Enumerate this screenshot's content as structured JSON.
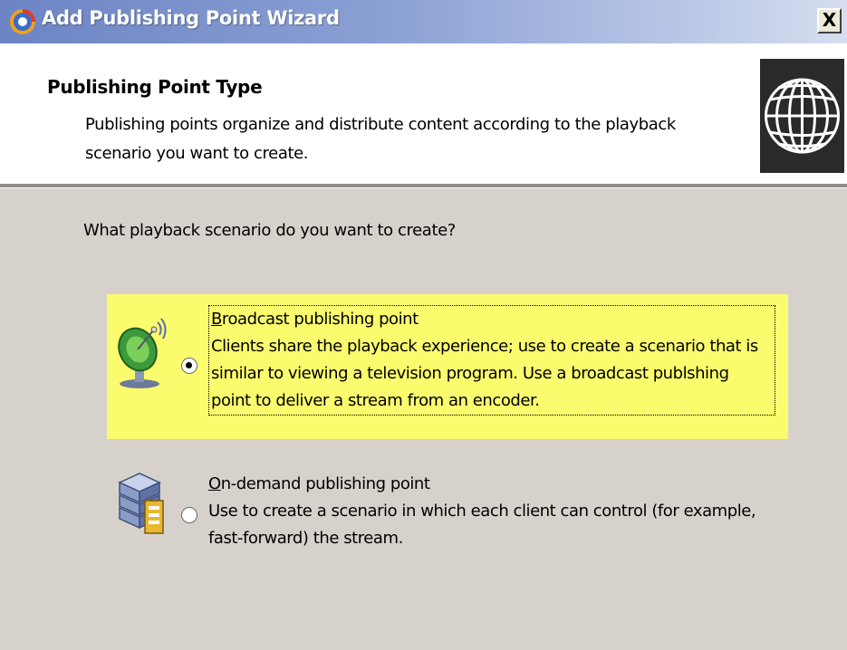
{
  "window": {
    "title": "Add Publishing Point Wizard",
    "close_label": "X"
  },
  "header": {
    "title": "Publishing Point Type",
    "description": "Publishing points organize and distribute content according to the playback scenario you want to create.",
    "logo_icon": "globe-icon"
  },
  "body": {
    "question": "What playback scenario do you want to create?",
    "options": [
      {
        "mnemonic": "B",
        "title_rest": "roadcast publishing point",
        "description": "Clients share the playback experience; use to create a scenario that is similar to viewing a television program. Use a broadcast publshing point to deliver a stream from an encoder.",
        "selected": true,
        "icon": "satellite-dish-icon"
      },
      {
        "mnemonic": "O",
        "title_rest": "n-demand publishing point",
        "description": "Use to create a scenario in which each client can control (for example, fast-forward) the stream.",
        "selected": false,
        "icon": "server-storage-icon"
      }
    ]
  },
  "colors": {
    "highlight": "#fbfb6e",
    "dialog_background": "#d6d2cb",
    "titlebar_start": "#6c84c4",
    "titlebar_end": "#d6deef"
  }
}
